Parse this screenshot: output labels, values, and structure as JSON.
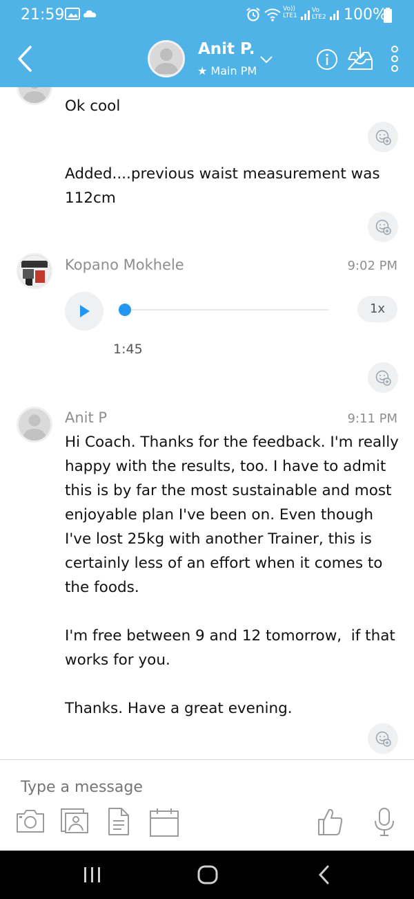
{
  "status_bar": {
    "time": "21:59",
    "battery_text": "100%",
    "icons": [
      "image-icon",
      "cloud-icon",
      "alarm-icon",
      "wifi-icon",
      "lte1-signal-icon",
      "lte2-signal-icon",
      "battery-icon"
    ],
    "lte1_label": "LTE1",
    "lte2_label": "LTE2",
    "volte_label": "Vo))"
  },
  "header": {
    "contact_name": "Anit P.",
    "contact_subtitle": "★ Main PM",
    "icons": [
      "back-icon",
      "chevron-down-icon",
      "info-icon",
      "inbox-download-icon",
      "more-vertical-icon"
    ]
  },
  "messages": [
    {
      "type": "text",
      "text": "Ok cool"
    },
    {
      "type": "text",
      "text": "Added....previous waist measurement was 112cm"
    },
    {
      "type": "voice",
      "sender": "Kopano Mokhele",
      "time": "9:02 PM",
      "duration": "1:45",
      "speed": "1x",
      "progress": 0.0
    },
    {
      "type": "text",
      "sender": "Anit P",
      "time": "9:11 PM",
      "text": "Hi Coach. Thanks for the feedback. I'm really happy with the results, too. I have to admit this is by far the most sustainable and most enjoyable plan I've been on. Even though I've lost 25kg with another Trainer, this is certainly less of an effort when it comes to the foods.\n\nI'm free between 9 and 12 tomorrow,  if that works for you.\n\nThanks. Have a great evening."
    }
  ],
  "composer": {
    "placeholder": "Type a message",
    "tools": [
      "camera-icon",
      "photo-gallery-icon",
      "document-icon",
      "calendar-icon",
      "thumbs-up-icon",
      "microphone-icon"
    ]
  },
  "colors": {
    "header_blue": "#4fb3e8",
    "play_blue": "#2196f3",
    "muted_text": "#8e8e8e",
    "reaction_bg": "#eef0f2"
  }
}
